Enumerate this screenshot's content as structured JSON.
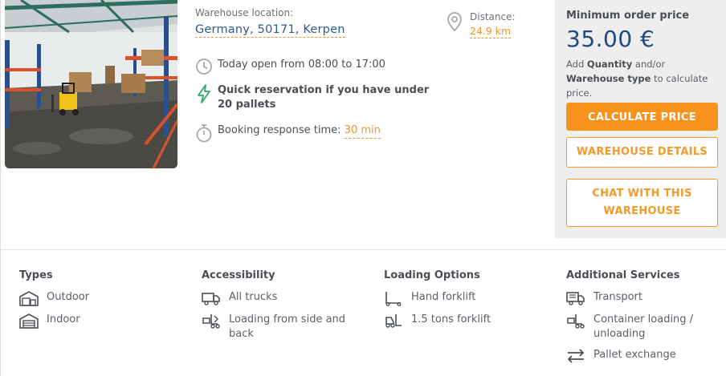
{
  "location": {
    "label": "Warehouse location:",
    "value": "Germany, 50171, Kerpen"
  },
  "distance": {
    "label": "Distance:",
    "value": "24.9 km"
  },
  "info": {
    "open_hours": "Today open from 08:00 to 17:00",
    "quick_reservation": "Quick reservation if you have under 20 pallets",
    "response_label": "Booking response time:",
    "response_value": "30 min"
  },
  "price": {
    "label": "Minimum order price",
    "value": "35.00 €",
    "hint_prefix": "Add ",
    "hint_quantity": "Quantity",
    "hint_middle": " and/or ",
    "hint_type": "Warehouse type",
    "hint_suffix": " to calculate price."
  },
  "buttons": {
    "calculate": "CALCULATE PRICE",
    "details": "WAREHOUSE DETAILS",
    "chat": "CHAT WITH THIS WAREHOUSE"
  },
  "features": {
    "types": {
      "title": "Types",
      "items": [
        "Outdoor",
        "Indoor"
      ]
    },
    "accessibility": {
      "title": "Accessibility",
      "items": [
        "All trucks",
        "Loading from side and back"
      ]
    },
    "loading": {
      "title": "Loading Options",
      "items": [
        "Hand forklift",
        "1.5 tons forklift"
      ]
    },
    "services": {
      "title": "Additional Services",
      "items": [
        "Transport",
        "Container loading / unloading",
        "Pallet exchange"
      ]
    }
  },
  "colors": {
    "accent_orange": "#f7931d",
    "price_blue": "#1f4a82",
    "link_blue": "#2d5a8e",
    "lightning_green": "#2ea86b"
  },
  "icons": {
    "distance": "map-pin-icon",
    "open": "clock-icon",
    "quick": "lightning-icon",
    "response": "stopwatch-icon"
  }
}
